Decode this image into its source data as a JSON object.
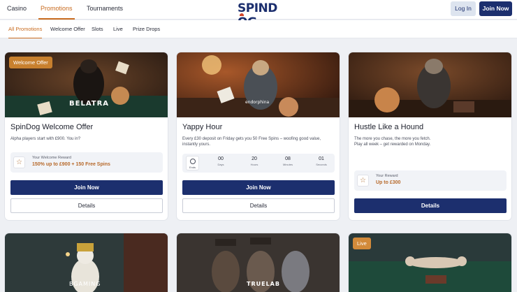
{
  "header": {
    "nav": [
      "Casino",
      "Promotions",
      "Tournaments"
    ],
    "logo": "SPINDOG",
    "login": "Log In",
    "join": "Join Now"
  },
  "subnav": [
    "All Promotions",
    "Welcome Offer",
    "Slots",
    "Live",
    "Prize Drops"
  ],
  "cards": [
    {
      "badge": "Welcome Offer",
      "image_text": "BELATRA",
      "title": "SpinDog Welcome Offer",
      "desc": "Alpha players start with £900. You in?",
      "reward_label": "Your Welcome Reward",
      "reward_value": "150% up to £900 + 150 Free Spins",
      "primary": "Join Now",
      "secondary": "Details"
    },
    {
      "image_text": "endorphina",
      "title": "Yappy Hour",
      "desc": "Every £30 deposit on Friday gets you 50 Free Spins – woofing good value, instantly yours.",
      "timer": {
        "ends_label": "Ends",
        "units": [
          {
            "num": "00",
            "label": "Days"
          },
          {
            "num": "20",
            "label": "Hours"
          },
          {
            "num": "08",
            "label": "Minutes"
          },
          {
            "num": "01",
            "label": "Seconds"
          }
        ]
      },
      "primary": "Join Now",
      "secondary": "Details"
    },
    {
      "title": "Hustle Like a Hound",
      "desc_line1": "The more you chase, the more you fetch.",
      "desc_line2": "Play all week – get rewarded on Monday.",
      "reward_label": "Your Reward",
      "reward_value": "Up to £300",
      "primary": "Details"
    }
  ],
  "bottom_cards": [
    {
      "image_text": "BGAMING"
    },
    {
      "image_text": "TRUELAB"
    },
    {
      "badge": "Live"
    }
  ],
  "colors": {
    "brand": "#1c2f6e",
    "accent": "#c86a1e",
    "background": "#eef0f4"
  }
}
